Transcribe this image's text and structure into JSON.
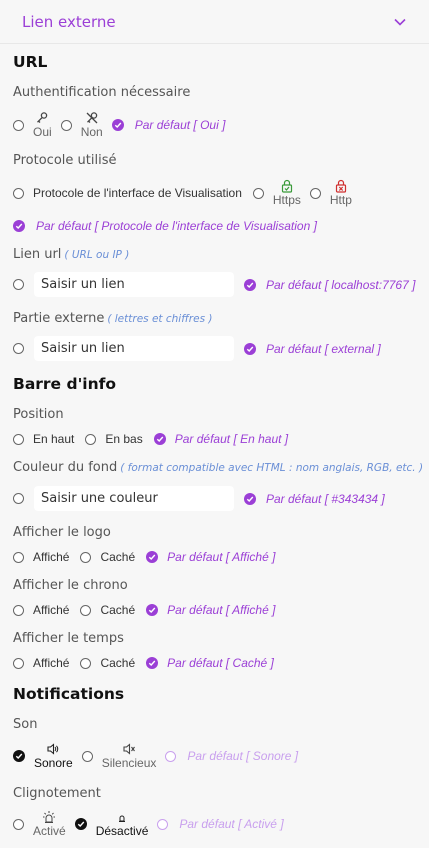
{
  "header": {
    "title": "Lien externe"
  },
  "url_section": {
    "title": "URL"
  },
  "auth": {
    "label": "Authentification nécessaire",
    "opt_yes": "Oui",
    "opt_no": "Non",
    "default": "Par défaut [ Oui ]"
  },
  "protocol": {
    "label": "Protocole utilisé",
    "opt_interface": "Protocole de l'interface de Visualisation",
    "opt_https": "Https",
    "opt_http": "Http",
    "default": "Par défaut [ Protocole de l'interface de Visualisation ]"
  },
  "link_url": {
    "label": "Lien url",
    "hint": "( URL ou IP )",
    "placeholder": "Saisir un lien",
    "default": "Par défaut [ localhost:7767 ]"
  },
  "external_part": {
    "label": "Partie externe",
    "hint": "( lettres et chiffres )",
    "placeholder": "Saisir un lien",
    "default": "Par défaut [ external ]"
  },
  "info_section": {
    "title": "Barre d'info"
  },
  "position": {
    "label": "Position",
    "opt_top": "En haut",
    "opt_bottom": "En bas",
    "default": "Par défaut [ En haut ]"
  },
  "bg_color": {
    "label": "Couleur du fond",
    "hint": "( format compatible avec HTML : nom anglais, RGB, etc. )",
    "placeholder": "Saisir une couleur",
    "default": "Par défaut [ #343434 ]"
  },
  "show_logo": {
    "label": "Afficher le logo",
    "opt_shown": "Affiché",
    "opt_hidden": "Caché",
    "default": "Par défaut [ Affiché ]"
  },
  "show_chrono": {
    "label": "Afficher le chrono",
    "opt_shown": "Affiché",
    "opt_hidden": "Caché",
    "default": "Par défaut [ Affiché ]"
  },
  "show_time": {
    "label": "Afficher le temps",
    "opt_shown": "Affiché",
    "opt_hidden": "Caché",
    "default": "Par défaut [ Caché ]"
  },
  "notif_section": {
    "title": "Notifications"
  },
  "sound": {
    "label": "Son",
    "opt_sound": "Sonore",
    "opt_silent": "Silencieux",
    "default": "Par défaut [ Sonore ]"
  },
  "blink": {
    "label": "Clignotement",
    "opt_on": "Activé",
    "opt_off": "Désactivé",
    "default": "Par défaut [ Activé ]"
  },
  "colors": {
    "accent": "#9b3fd6",
    "accent_light": "#c9a0ee",
    "hint": "#6a8fd6",
    "background": "#f7f7f7"
  },
  "icons": [
    "chevron-down-icon",
    "key-icon",
    "key-off-icon",
    "lock-check-icon",
    "lock-x-icon",
    "speaker-on-icon",
    "speaker-mute-icon",
    "alarm-light-on-icon",
    "alarm-light-off-icon",
    "check-icon"
  ]
}
